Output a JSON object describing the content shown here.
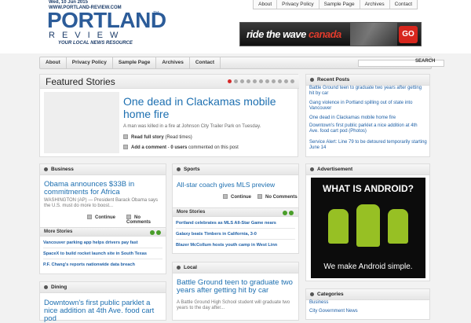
{
  "header": {
    "date": "Wed, 10 Jun 2015",
    "site_url": "WWW.PORTLAND-REVIEW.COM",
    "logo_main": "PORTLAND",
    "logo_tm": "TM",
    "logo_sub": "REVIEW",
    "tagline": "YOUR LOCAL NEWS RESOURCE",
    "top_links": [
      "About",
      "Privacy Policy",
      "Sample Page",
      "Archives",
      "Contact"
    ],
    "ad": {
      "text_main": "ride the wave ",
      "text_accent": "canada",
      "go": "GO",
      "accent_color": "#d7261d"
    }
  },
  "nav": {
    "items": [
      "About",
      "Privacy Policy",
      "Sample Page",
      "Archives",
      "Contact"
    ],
    "search_button": "SEARCH",
    "search_value": ""
  },
  "featured": {
    "title": "Featured Stories",
    "headline": "One dead in Clackamas mobile home fire",
    "excerpt": "A man was killed in a fire at Johnson City Trailer Park on Tuesday.",
    "read_full_bold": "Read full story",
    "read_full_rest": " (Read times)",
    "comment_bold": "Add a comment",
    "comment_sep": " - ",
    "comment_users_bold": "0 users",
    "comment_rest": " commented on this post",
    "dots": 11
  },
  "business": {
    "title": "Business",
    "headline": "Obama announces $33B in commitments for Africa",
    "excerpt": "WASHINGTON (AP) — President Barack Obama says the U.S. must do more to boost...",
    "continue": "Continue",
    "comments": "No Comments",
    "more_title": "More Stories",
    "more": [
      "Vancouver parking app helps drivers pay fast",
      "SpaceX to build rocket launch site in South Texas",
      "P.F. Chang's reports nationwide data breach"
    ]
  },
  "sports": {
    "title": "Sports",
    "headline": "All-star coach gives MLS preview",
    "continue": "Continue",
    "comments": "No Comments",
    "more_title": "More Stories",
    "more": [
      "Portland celebrates as MLS All-Star Game nears",
      "Galaxy beats Timbers in California, 3-0",
      "Blazer McCollum hosts youth camp in West Linn"
    ]
  },
  "dining": {
    "title": "Dining",
    "headline": "Downtown's first public parklet a nice addition at 4th Ave. food cart pod"
  },
  "local": {
    "title": "Local",
    "headline": "Battle Ground teen to graduate two years after getting hit by car",
    "excerpt": "A Battle Ground High School student will graduate two years to the day after..."
  },
  "recent": {
    "title": "Recent Posts",
    "items": [
      "Battle Ground teen to graduate two years after getting hit by car",
      "Gang violence in Portland spilling out of state into Vancouver",
      "One dead in Clackamas mobile home fire",
      "Downtown's first public parklet a nice addition at 4th Ave. food cart pod (Photos)",
      "Service Alert: Line 79 to be detoured temporarily starting June 14"
    ]
  },
  "advert": {
    "title": "Advertisement",
    "headline": "WHAT IS ANDROID?",
    "slogan": "We make Android simple."
  },
  "categories": {
    "title": "Categories",
    "items": [
      "Business",
      "City Government News"
    ]
  }
}
